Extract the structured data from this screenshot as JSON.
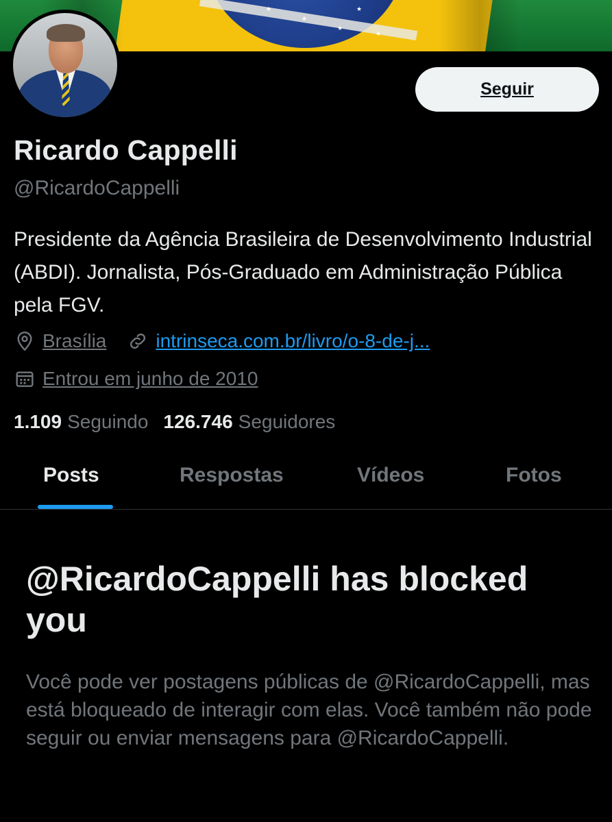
{
  "profile": {
    "name": "Ricardo Cappelli",
    "handle": "@RicardoCappelli",
    "bio": "Presidente da Agência Brasileira de Desenvolvimento Industrial (ABDI). Jornalista, Pós-Graduado em Administração Pública pela FGV.",
    "location": "Brasília",
    "website": "intrinseca.com.br/livro/o-8-de-j...",
    "joined": "Entrou em junho de 2010",
    "following_count": "1.109",
    "following_label": "Seguindo",
    "followers_count": "126.746",
    "followers_label": "Seguidores"
  },
  "actions": {
    "follow_label": "Seguir"
  },
  "tabs": [
    {
      "label": "Posts",
      "active": true
    },
    {
      "label": "Respostas",
      "active": false
    },
    {
      "label": "Vídeos",
      "active": false
    },
    {
      "label": "Fotos",
      "active": false
    }
  ],
  "blocked": {
    "title": "@RicardoCappelli has blocked you",
    "message": "Você pode ver postagens públicas de @RicardoCappelli, mas está bloqueado de interagir com elas. Você também não pode seguir ou enviar mensagens para @RicardoCappelli."
  },
  "icons": {
    "location": "location-pin-icon",
    "link": "link-icon",
    "joined": "calendar-icon"
  },
  "colors": {
    "background": "#000000",
    "accent": "#1d9bf0",
    "primary_text": "#e7e9ea",
    "secondary_text": "#71767b",
    "button_bg": "#eff3f4"
  }
}
